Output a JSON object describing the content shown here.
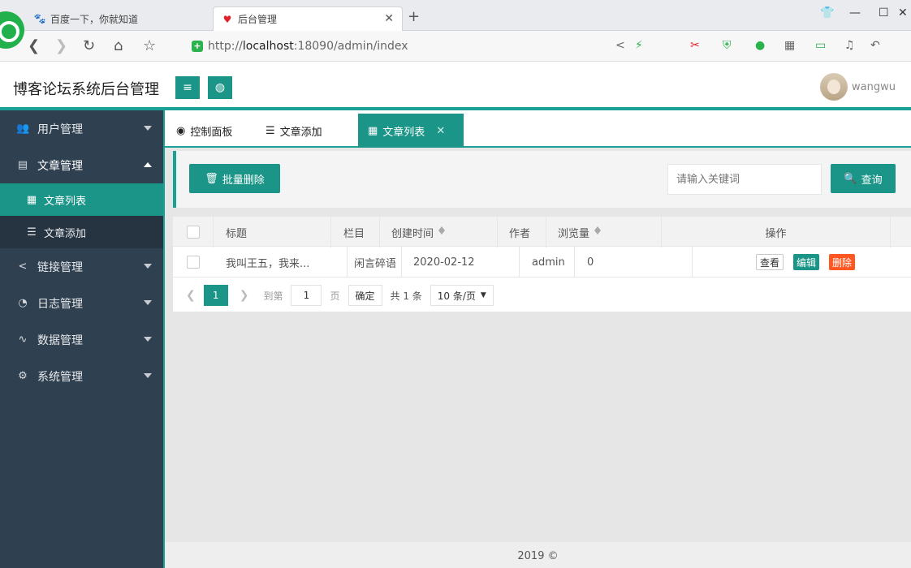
{
  "browser": {
    "tabs": [
      {
        "label": "百度一下，你就知道",
        "icon": "paw-icon"
      },
      {
        "label": "后台管理",
        "icon": "heart-icon"
      }
    ],
    "url_prefix": "http://",
    "url_host": "localhost",
    "url_rest": ":18090/admin/index"
  },
  "header": {
    "title": "博客论坛系统后台管理",
    "username": "wangwu"
  },
  "sidebar": {
    "items": [
      {
        "label": "用户管理",
        "icon": "users-icon"
      },
      {
        "label": "文章管理",
        "icon": "article-icon",
        "expanded": true
      },
      {
        "label": "链接管理",
        "icon": "share-icon"
      },
      {
        "label": "日志管理",
        "icon": "log-icon"
      },
      {
        "label": "数据管理",
        "icon": "pulse-icon"
      },
      {
        "label": "系统管理",
        "icon": "gears-icon"
      }
    ],
    "sub_items": [
      {
        "label": "文章列表",
        "icon": "table-icon",
        "active": true
      },
      {
        "label": "文章添加",
        "icon": "list-icon"
      }
    ]
  },
  "tabs": [
    {
      "label": "控制面板",
      "icon": "dashboard-icon"
    },
    {
      "label": "文章添加",
      "icon": "list-icon"
    },
    {
      "label": "文章列表",
      "icon": "table-icon",
      "active": true
    }
  ],
  "toolbar": {
    "batch_delete_label": "批量删除",
    "search_placeholder": "请输入关键词",
    "search_label": "查询"
  },
  "table": {
    "columns": [
      "标题",
      "栏目",
      "创建时间",
      "作者",
      "浏览量",
      "操作"
    ],
    "rows": [
      {
        "title": "我叫王五，我来...",
        "category": "闲言碎语",
        "created": "2020-02-12",
        "author": "admin",
        "views": "0"
      }
    ],
    "actions": {
      "view": "查看",
      "edit": "编辑",
      "delete": "删除"
    }
  },
  "pager": {
    "current": "1",
    "goto_label": "到第",
    "goto_value": "1",
    "page_unit": "页",
    "confirm": "确定",
    "total": "共 1 条",
    "limit": "10 条/页"
  },
  "footer": {
    "text": "2019 ©"
  },
  "colors": {
    "accent": "#1a9588",
    "sidebar": "#2f4050",
    "danger": "#ff5722"
  }
}
